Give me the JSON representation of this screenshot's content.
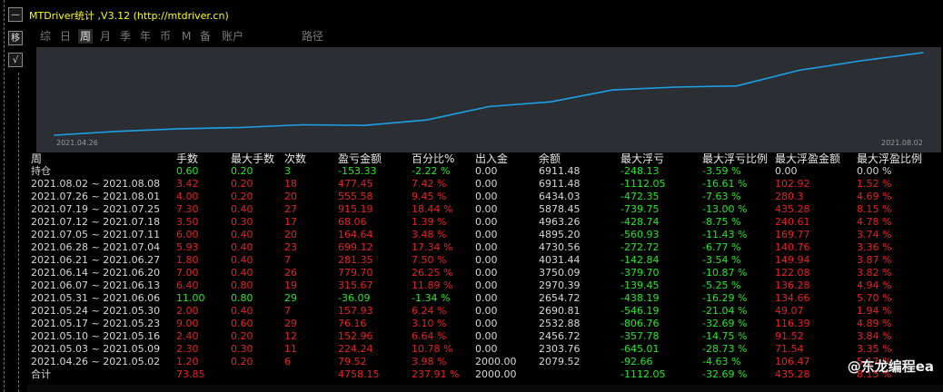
{
  "left_buttons": [
    "—",
    "移",
    "√"
  ],
  "title": "MTDriver统计 ,V3.12 (http://mtdriver.cn)",
  "tabs": [
    "综",
    "日",
    "周",
    "月",
    "季",
    "年",
    "币",
    "M",
    "备",
    "账户",
    "路径"
  ],
  "active_tab": "周",
  "chart_data": {
    "type": "line",
    "x_labels": [
      "2021.04.26",
      "2021.08.02"
    ],
    "x": [
      "2021.04.26",
      "2021.05.03",
      "2021.05.10",
      "2021.05.17",
      "2021.05.24",
      "2021.05.31",
      "2021.06.07",
      "2021.06.14",
      "2021.06.21",
      "2021.06.28",
      "2021.07.05",
      "2021.07.12",
      "2021.07.19",
      "2021.07.26",
      "2021.08.02"
    ],
    "values": [
      79.52,
      303.76,
      456.72,
      532.88,
      690.81,
      654.72,
      970.39,
      1750.09,
      2031.44,
      2730.56,
      2895.2,
      2963.26,
      3878.45,
      4434.03,
      4911.48
    ],
    "color": "#1ea0e8"
  },
  "columns": [
    "周",
    "手数",
    "最大手数",
    "次数",
    "盈亏金额",
    "百分比%",
    "出入金",
    "余额",
    "最大浮亏",
    "最大浮亏比例",
    "最大浮盈金额",
    "最大浮盈比例"
  ],
  "holding": [
    "持仓",
    "0.60",
    "0.20",
    "3",
    "-153.33",
    "-2.22 %",
    "0.00",
    "6911.48",
    "-248.13",
    "-3.59 %",
    "0.00",
    "0.00 %"
  ],
  "rows": [
    [
      "2021.08.02 ~ 2021.08.08",
      "3.42",
      "0.20",
      "18",
      "477.45",
      "7.42 %",
      "0.00",
      "6911.48",
      "-1112.05",
      "-16.61 %",
      "102.92",
      "1.52 %"
    ],
    [
      "2021.07.26 ~ 2021.08.01",
      "4.00",
      "0.20",
      "20",
      "555.58",
      "9.45 %",
      "0.00",
      "6434.03",
      "-472.35",
      "-7.63 %",
      "280.3",
      "4.69 %"
    ],
    [
      "2021.07.19 ~ 2021.07.25",
      "7.30",
      "0.40",
      "27",
      "915.19",
      "18.44 %",
      "0.00",
      "5878.45",
      "-739.75",
      "-13.00 %",
      "435.28",
      "8.15 %"
    ],
    [
      "2021.07.12 ~ 2021.07.18",
      "3.50",
      "0.30",
      "17",
      "68.06",
      "1.39 %",
      "0.00",
      "4963.26",
      "-428.74",
      "-8.75 %",
      "240.61",
      "4.78 %"
    ],
    [
      "2021.07.05 ~ 2021.07.11",
      "6.00",
      "0.40",
      "20",
      "164.64",
      "3.48 %",
      "0.00",
      "4895.20",
      "-560.93",
      "-11.43 %",
      "169.77",
      "3.74 %"
    ],
    [
      "2021.06.28 ~ 2021.07.04",
      "5.93",
      "0.40",
      "23",
      "699.12",
      "17.34 %",
      "0.00",
      "4730.56",
      "-272.72",
      "-6.77 %",
      "140.76",
      "3.36 %"
    ],
    [
      "2021.06.21 ~ 2021.06.27",
      "1.80",
      "0.40",
      "7",
      "281.35",
      "7.50 %",
      "0.00",
      "4031.44",
      "-142.84",
      "-3.54 %",
      "149.94",
      "3.87 %"
    ],
    [
      "2021.06.14 ~ 2021.06.20",
      "7.00",
      "0.40",
      "26",
      "779.70",
      "26.25 %",
      "0.00",
      "3750.09",
      "-379.70",
      "-10.87 %",
      "122.08",
      "3.82 %"
    ],
    [
      "2021.06.07 ~ 2021.06.13",
      "6.40",
      "0.80",
      "19",
      "315.67",
      "11.89 %",
      "0.00",
      "2970.39",
      "-139.45",
      "-5.25 %",
      "136.28",
      "4.94 %"
    ],
    [
      "2021.05.31 ~ 2021.06.06",
      "11.00",
      "0.80",
      "29",
      "-36.09",
      "-1.34 %",
      "0.00",
      "2654.72",
      "-438.19",
      "-16.29 %",
      "134.66",
      "5.70 %"
    ],
    [
      "2021.05.24 ~ 2021.05.30",
      "2.00",
      "0.40",
      "7",
      "157.93",
      "6.24 %",
      "0.00",
      "2690.81",
      "-546.19",
      "-21.04 %",
      "49.07",
      "1.94 %"
    ],
    [
      "2021.05.17 ~ 2021.05.23",
      "9.00",
      "0.60",
      "29",
      "76.16",
      "3.10 %",
      "0.00",
      "2532.88",
      "-806.76",
      "-32.69 %",
      "116.39",
      "4.89 %"
    ],
    [
      "2021.05.10 ~ 2021.05.16",
      "2.40",
      "0.20",
      "12",
      "152.96",
      "6.64 %",
      "0.00",
      "2456.72",
      "-357.78",
      "-14.75 %",
      "91.52",
      "3.84 %"
    ],
    [
      "2021.05.03 ~ 2021.05.09",
      "2.30",
      "0.30",
      "11",
      "224.24",
      "10.78 %",
      "0.00",
      "2303.76",
      "-645.01",
      "-28.73 %",
      "71.54",
      "3.35 %"
    ],
    [
      "2021.04.26 ~ 2021.05.02",
      "1.20",
      "0.20",
      "6",
      "79.52",
      "3.98 %",
      "2000.00",
      "2079.52",
      "-92.66",
      "-4.63 %",
      "106.47",
      "5.17 %"
    ]
  ],
  "total": [
    "合计",
    "73.85",
    "",
    "",
    "4758.15",
    "237.91 %",
    "2000.00",
    "",
    "-1112.05",
    "-32.69 %",
    "435.28",
    "8.15 %"
  ],
  "watermark": "@东龙编程ea",
  "colors": {
    "profit": "#e82222",
    "loss": "#22e822",
    "neutral": "#d8d8d8",
    "title": "#ffff00",
    "line": "#1ea0e8"
  }
}
